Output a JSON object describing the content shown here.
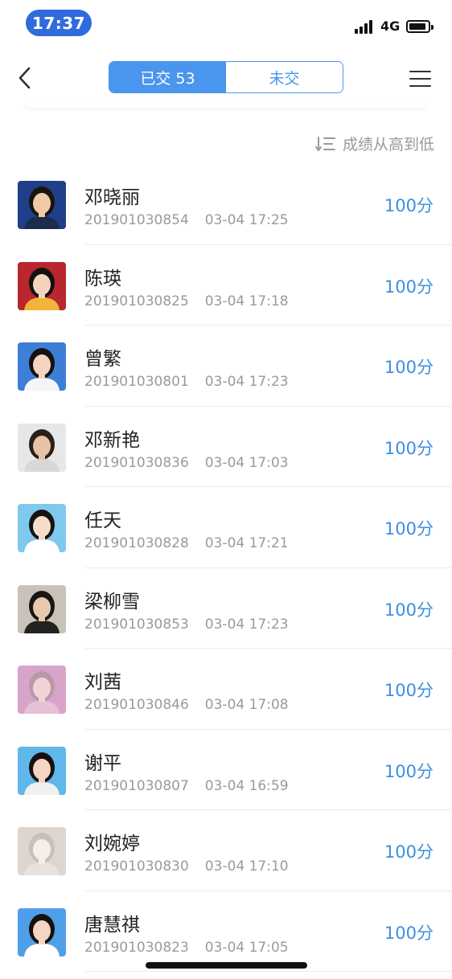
{
  "status": {
    "time": "17:37",
    "network": "4G"
  },
  "header": {
    "back_icon": "chevron-left-icon",
    "tabs": [
      {
        "label": "已交 53",
        "active": true
      },
      {
        "label": "未交",
        "active": false
      }
    ],
    "menu_icon": "hamburger-menu-icon"
  },
  "sort": {
    "label": "成绩从高到低",
    "icon": "sort-descending-icon"
  },
  "students": [
    {
      "name": "邓晓丽",
      "id": "201901030854",
      "time": "03-04 17:25",
      "score": "100分",
      "avatar": {
        "bg": "#1f3f8a",
        "skin": "#f0c9a6",
        "hair": "#1a1410",
        "cloth": "#1d2b4d"
      }
    },
    {
      "name": "陈瑛",
      "id": "201901030825",
      "time": "03-04 17:18",
      "score": "100分",
      "avatar": {
        "bg": "#b8262e",
        "skin": "#f4d3bd",
        "hair": "#151010",
        "cloth": "#f2b53a"
      }
    },
    {
      "name": "曾繁",
      "id": "201901030801",
      "time": "03-04 17:23",
      "score": "100分",
      "avatar": {
        "bg": "#3d7fd6",
        "skin": "#f3d4c2",
        "hair": "#17120f",
        "cloth": "#f5f5f5"
      }
    },
    {
      "name": "邓新艳",
      "id": "201901030836",
      "time": "03-04 17:03",
      "score": "100分",
      "avatar": {
        "bg": "#e7e7e7",
        "skin": "#e6c2a6",
        "hair": "#2a1f18",
        "cloth": "#d8d8d8"
      }
    },
    {
      "name": "任天",
      "id": "201901030828",
      "time": "03-04 17:21",
      "score": "100分",
      "avatar": {
        "bg": "#7fc8ee",
        "skin": "#f6dccb",
        "hair": "#17120f",
        "cloth": "#ffffff"
      }
    },
    {
      "name": "梁柳雪",
      "id": "201901030853",
      "time": "03-04 17:23",
      "score": "100分",
      "avatar": {
        "bg": "#c8c2b8",
        "skin": "#e8c9ae",
        "hair": "#1b1613",
        "cloth": "#222222"
      }
    },
    {
      "name": "刘茜",
      "id": "201901030846",
      "time": "03-04 17:08",
      "score": "100分",
      "avatar": {
        "bg": "#d9a4c9",
        "skin": "#f2d3d6",
        "hair": "#b79aa8",
        "cloth": "#e5c0d6"
      }
    },
    {
      "name": "谢平",
      "id": "201901030807",
      "time": "03-04 16:59",
      "score": "100分",
      "avatar": {
        "bg": "#5fb7ea",
        "skin": "#f3d6c4",
        "hair": "#16110e",
        "cloth": "#f0f0f0"
      }
    },
    {
      "name": "刘婉婷",
      "id": "201901030830",
      "time": "03-04 17:10",
      "score": "100分",
      "avatar": {
        "bg": "#ddd5cf",
        "skin": "#f4efe9",
        "hair": "#c9bfb6",
        "cloth": "#e9e2dc"
      }
    },
    {
      "name": "唐慧祺",
      "id": "201901030823",
      "time": "03-04 17:05",
      "score": "100分",
      "avatar": {
        "bg": "#4f9fe8",
        "skin": "#f3d6c4",
        "hair": "#16110e",
        "cloth": "#ffffff"
      }
    }
  ],
  "colors": {
    "accent": "#4a95ee",
    "score": "#3b8fe0",
    "time_pill": "#2f6bdc",
    "muted": "#9a9a9a"
  }
}
